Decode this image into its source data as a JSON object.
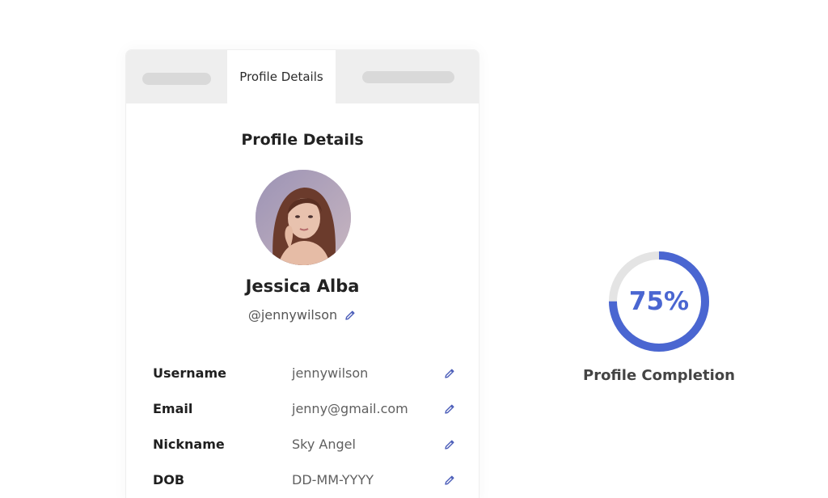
{
  "tabs": {
    "active_label": "Profile Details"
  },
  "profile": {
    "section_title": "Profile Details",
    "name": "Jessica Alba",
    "handle": "@jennywilson"
  },
  "fields": [
    {
      "label": "Username",
      "value": "jennywilson"
    },
    {
      "label": "Email",
      "value": "jenny@gmail.com"
    },
    {
      "label": "Nickname",
      "value": "Sky Angel"
    },
    {
      "label": "DOB",
      "value": "DD-MM-YYYY"
    }
  ],
  "completion": {
    "percent_text": "75%",
    "fraction": 0.75,
    "label": "Profile Completion"
  },
  "colors": {
    "accent": "#4a66d1",
    "track": "#e4e4e4",
    "icon": "#4a5cb8"
  },
  "icons": {
    "edit": "pencil-icon",
    "avatar": "user-avatar-photo"
  }
}
